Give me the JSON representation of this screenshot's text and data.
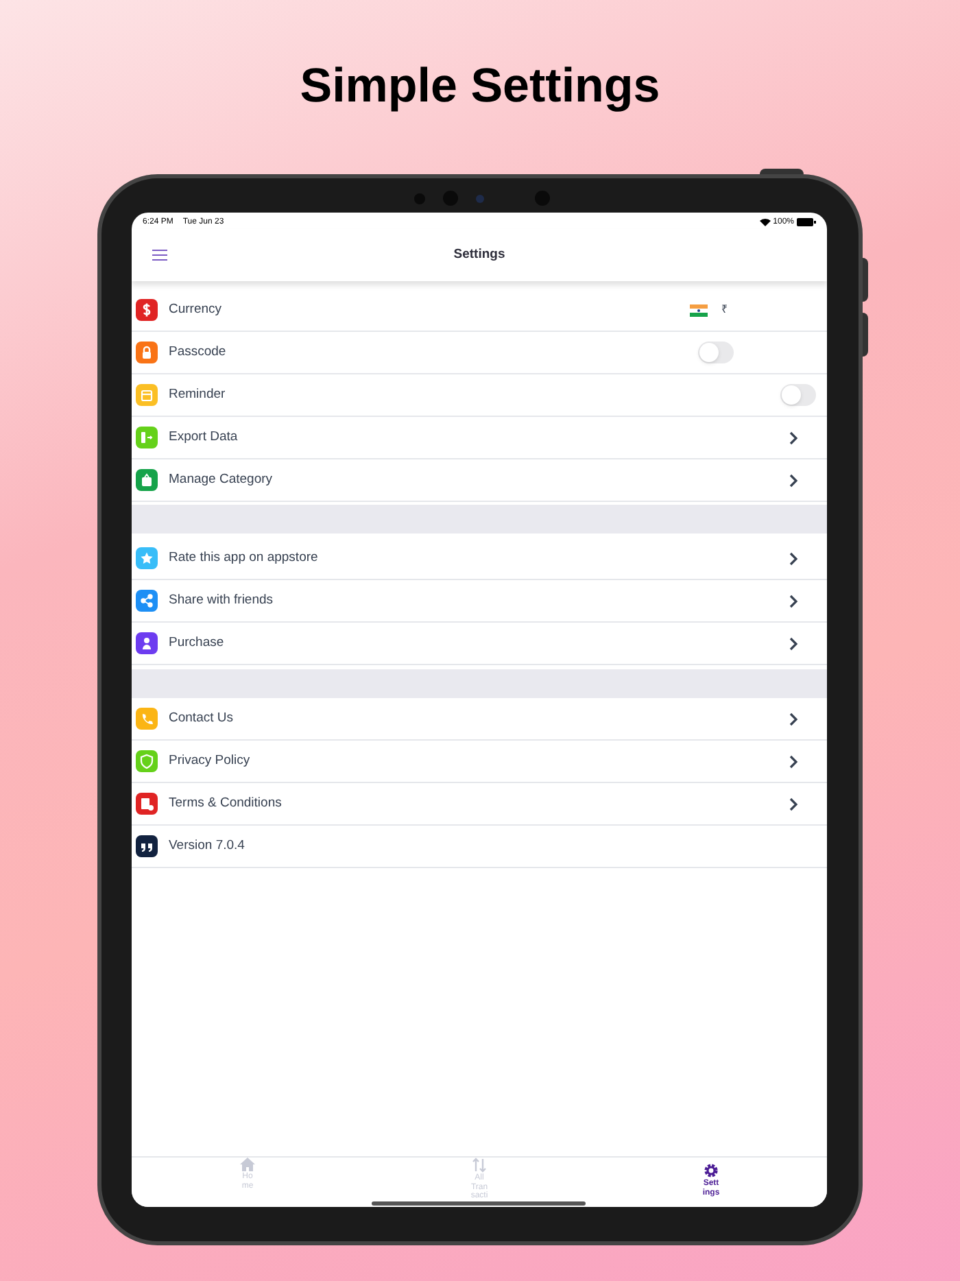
{
  "headline": "Simple Settings",
  "status_bar": {
    "time": "6:24 PM",
    "date": "Tue Jun 23",
    "battery": "100%"
  },
  "header": {
    "title": "Settings"
  },
  "sections": [
    {
      "rows": [
        {
          "kind": "value",
          "label": "Currency",
          "color": "#e02424",
          "value": "₹"
        },
        {
          "kind": "toggle",
          "label": "Passcode",
          "color": "#f97316",
          "on": false
        },
        {
          "kind": "toggle",
          "label": "Reminder",
          "color": "#fbbf24",
          "on": false
        },
        {
          "kind": "link",
          "label": "Export Data",
          "color": "#65d11a"
        },
        {
          "kind": "link",
          "label": "Manage Category",
          "color": "#16a34a"
        }
      ]
    },
    {
      "rows": [
        {
          "kind": "link",
          "label": "Rate this app on appstore",
          "color": "#38bdf8"
        },
        {
          "kind": "link",
          "label": "Share with friends",
          "color": "#1d8ff5"
        },
        {
          "kind": "link",
          "label": "Purchase",
          "color": "#6d3cf0"
        }
      ]
    },
    {
      "rows": [
        {
          "kind": "link",
          "label": "Contact Us",
          "color": "#fbb515"
        },
        {
          "kind": "link",
          "label": "Privacy Policy",
          "color": "#65d11a"
        },
        {
          "kind": "link",
          "label": "Terms & Conditions",
          "color": "#e02424"
        },
        {
          "kind": "plain",
          "label": "Version 7.0.4",
          "color": "#12223f"
        }
      ]
    }
  ],
  "tabs": [
    {
      "lines": [
        "Ho",
        "me"
      ],
      "selected": false
    },
    {
      "lines": [
        "All",
        "Tran",
        "sacti"
      ],
      "selected": false
    },
    {
      "lines": [
        "Sett",
        "ings"
      ],
      "selected": true
    }
  ]
}
